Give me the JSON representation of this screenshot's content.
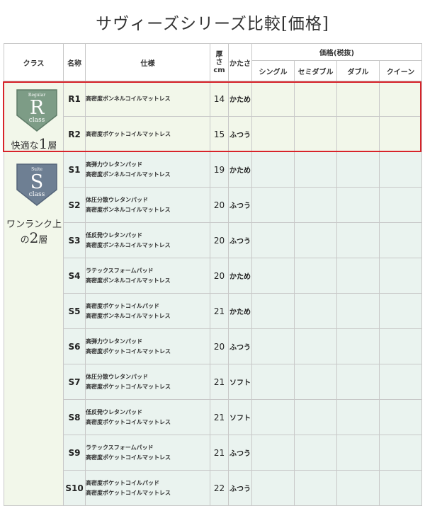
{
  "title": "サヴィーズシリーズ比較[価格]",
  "headers": {
    "class": "クラス",
    "name": "名称",
    "spec": "仕様",
    "thickness_1": "厚",
    "thickness_2": "さ",
    "thickness_3": "cm",
    "hardness": "かたさ",
    "price": "価格(税抜)",
    "single": "シングル",
    "semi_double": "セミダブル",
    "double": "ダブル",
    "queen": "クイーン"
  },
  "classes": {
    "regular": {
      "badge_small": "Regular",
      "badge_letter": "R",
      "badge_word": "class",
      "caption_pre": "快適な",
      "caption_num": "1",
      "caption_post": "層"
    },
    "suite": {
      "badge_small": "Suite",
      "badge_letter": "S",
      "badge_word": "class",
      "caption_line1": "ワンランク上",
      "caption_pre": "の",
      "caption_num": "2",
      "caption_post": "層"
    }
  },
  "rows": [
    {
      "code": "R1",
      "spec1": "高密度ボンネルコイルマットレス",
      "spec2": "",
      "thickness": "14",
      "hardness": "かため"
    },
    {
      "code": "R2",
      "spec1": "高密度ポケットコイルマットレス",
      "spec2": "",
      "thickness": "15",
      "hardness": "ふつう"
    },
    {
      "code": "S1",
      "spec1": "高弾力ウレタンパッド",
      "spec2": "高密度ボンネルコイルマットレス",
      "thickness": "19",
      "hardness": "かため"
    },
    {
      "code": "S2",
      "spec1": "体圧分散ウレタンパッド",
      "spec2": "高密度ボンネルコイルマットレス",
      "thickness": "20",
      "hardness": "ふつう"
    },
    {
      "code": "S3",
      "spec1": "低反発ウレタンパッド",
      "spec2": "高密度ボンネルコイルマットレス",
      "thickness": "20",
      "hardness": "ふつう"
    },
    {
      "code": "S4",
      "spec1": "ラテックスフォームパッド",
      "spec2": "高密度ボンネルコイルマットレス",
      "thickness": "20",
      "hardness": "かため"
    },
    {
      "code": "S5",
      "spec1": "高密度ポケットコイルパッド",
      "spec2": "高密度ボンネルコイルマットレス",
      "thickness": "21",
      "hardness": "かため"
    },
    {
      "code": "S6",
      "spec1": "高弾力ウレタンパッド",
      "spec2": "高密度ポケットコイルマットレス",
      "thickness": "20",
      "hardness": "ふつう"
    },
    {
      "code": "S7",
      "spec1": "体圧分散ウレタンパッド",
      "spec2": "高密度ポケットコイルマットレス",
      "thickness": "21",
      "hardness": "ソフト"
    },
    {
      "code": "S8",
      "spec1": "低反発ウレタンパッド",
      "spec2": "高密度ポケットコイルマットレス",
      "thickness": "21",
      "hardness": "ソフト"
    },
    {
      "code": "S9",
      "spec1": "ラテックスフォームパッド",
      "spec2": "高密度ポケットコイルマットレス",
      "thickness": "21",
      "hardness": "ふつう"
    },
    {
      "code": "S10",
      "spec1": "高密度ポケットコイルパッド",
      "spec2": "高密度ポケットコイルマットレス",
      "thickness": "22",
      "hardness": "ふつう"
    }
  ],
  "colors": {
    "regular_badge": "#7d9c86",
    "suite_badge": "#6e7f93",
    "highlight_border": "#d8232a",
    "row_bg": "#eaf3ef"
  }
}
